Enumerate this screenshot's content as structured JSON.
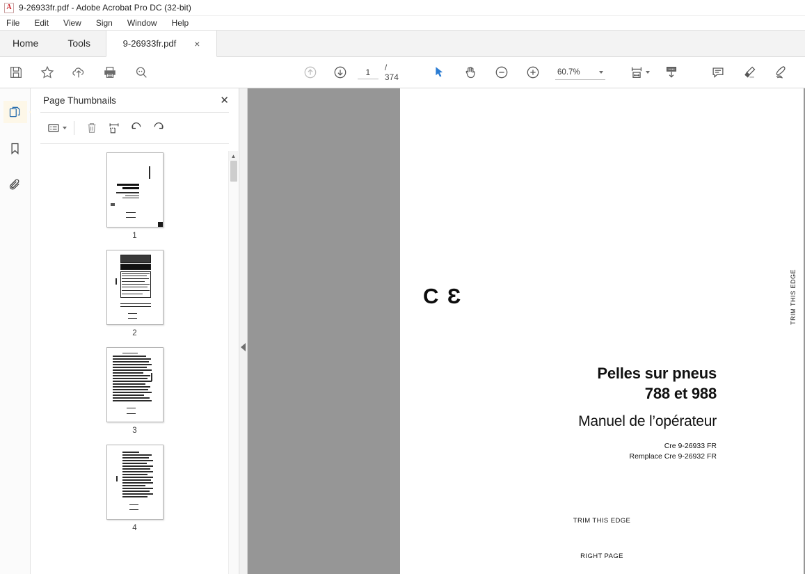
{
  "window": {
    "title": "9-26933fr.pdf - Adobe Acrobat Pro DC (32-bit)",
    "app_icon": "acrobat-icon"
  },
  "menubar": {
    "items": [
      {
        "label": "File"
      },
      {
        "label": "Edit"
      },
      {
        "label": "View"
      },
      {
        "label": "Sign"
      },
      {
        "label": "Window"
      },
      {
        "label": "Help"
      }
    ]
  },
  "tabbar": {
    "home_label": "Home",
    "tools_label": "Tools",
    "document_tab": "9-26933fr.pdf",
    "close_glyph": "×"
  },
  "toolbar": {
    "left_buttons": [
      {
        "name": "save-button",
        "icon": "save-floppy-icon"
      },
      {
        "name": "add-to-favorites-button",
        "icon": "star-icon"
      },
      {
        "name": "upload-to-cloud-button",
        "icon": "cloud-upload-icon"
      },
      {
        "name": "print-button",
        "icon": "printer-icon"
      },
      {
        "name": "find-button",
        "icon": "search-magnifier-icon"
      }
    ],
    "nav": {
      "previous_page_icon": "arrow-up-circle-icon",
      "next_page_icon": "arrow-down-circle-icon",
      "page_value": "1",
      "page_total": "/ 374"
    },
    "tools": {
      "select_icon": "cursor-arrow-icon",
      "hand_icon": "hand-pan-icon",
      "zoom_out_icon": "minus-circle-icon",
      "zoom_in_icon": "plus-circle-icon",
      "zoom_value": "60.7%"
    },
    "right_buttons": [
      {
        "name": "fit-page-button",
        "icon": "fit-width-icon"
      },
      {
        "name": "scroll-mode-button",
        "icon": "page-scroll-icon"
      },
      {
        "name": "comment-button",
        "icon": "comment-bubble-icon"
      },
      {
        "name": "highlight-button",
        "icon": "highlighter-pen-icon"
      },
      {
        "name": "sign-button",
        "icon": "signature-pen-icon"
      },
      {
        "name": "fill-and-sign-button",
        "icon": "fill-sign-icon"
      }
    ]
  },
  "rail": {
    "items": [
      {
        "name": "page-thumbnails-icon",
        "label": "Page Thumbnails",
        "active": true
      },
      {
        "name": "bookmarks-icon",
        "label": "Bookmarks",
        "active": false
      },
      {
        "name": "attachments-icon",
        "label": "Attachments",
        "active": false
      }
    ]
  },
  "thumbnail_panel": {
    "title": "Page Thumbnails",
    "close_glyph": "✕",
    "tools": [
      {
        "name": "page-options-button",
        "icon": "list-options-icon"
      },
      {
        "name": "delete-pages-button",
        "icon": "trash-icon"
      },
      {
        "name": "extract-pages-button",
        "icon": "extract-pages-icon"
      },
      {
        "name": "rotate-counterclockwise-button",
        "icon": "rotate-ccw-icon"
      },
      {
        "name": "rotate-clockwise-button",
        "icon": "rotate-cw-icon"
      }
    ],
    "thumbnails": [
      {
        "number": "1",
        "kind": "cover",
        "current": true
      },
      {
        "number": "2",
        "kind": "attention",
        "current": false
      },
      {
        "number": "3",
        "kind": "contents",
        "current": false
      },
      {
        "number": "4",
        "kind": "contents",
        "current": false
      }
    ]
  },
  "document": {
    "title_line1": "Pelles sur pneus",
    "title_line2": "788 et 988",
    "subtitle": "Manuel de l’opérateur",
    "code_line1": "Cre 9-26933 FR",
    "code_line2": "Remplace Cre 9-26932 FR",
    "ce_mark": "C Ɛ",
    "trim_edge_side": "TRIM THIS EDGE",
    "trim_edge_bottom": "TRIM THIS EDGE",
    "right_page": "RIGHT PAGE"
  },
  "colors": {
    "accent_blue": "#2b7cd3",
    "doc_background": "#969696",
    "tab_bar": "#f3f3f3",
    "icon_gray": "#5d5d5d",
    "rail_active": "#fdf7e8"
  }
}
